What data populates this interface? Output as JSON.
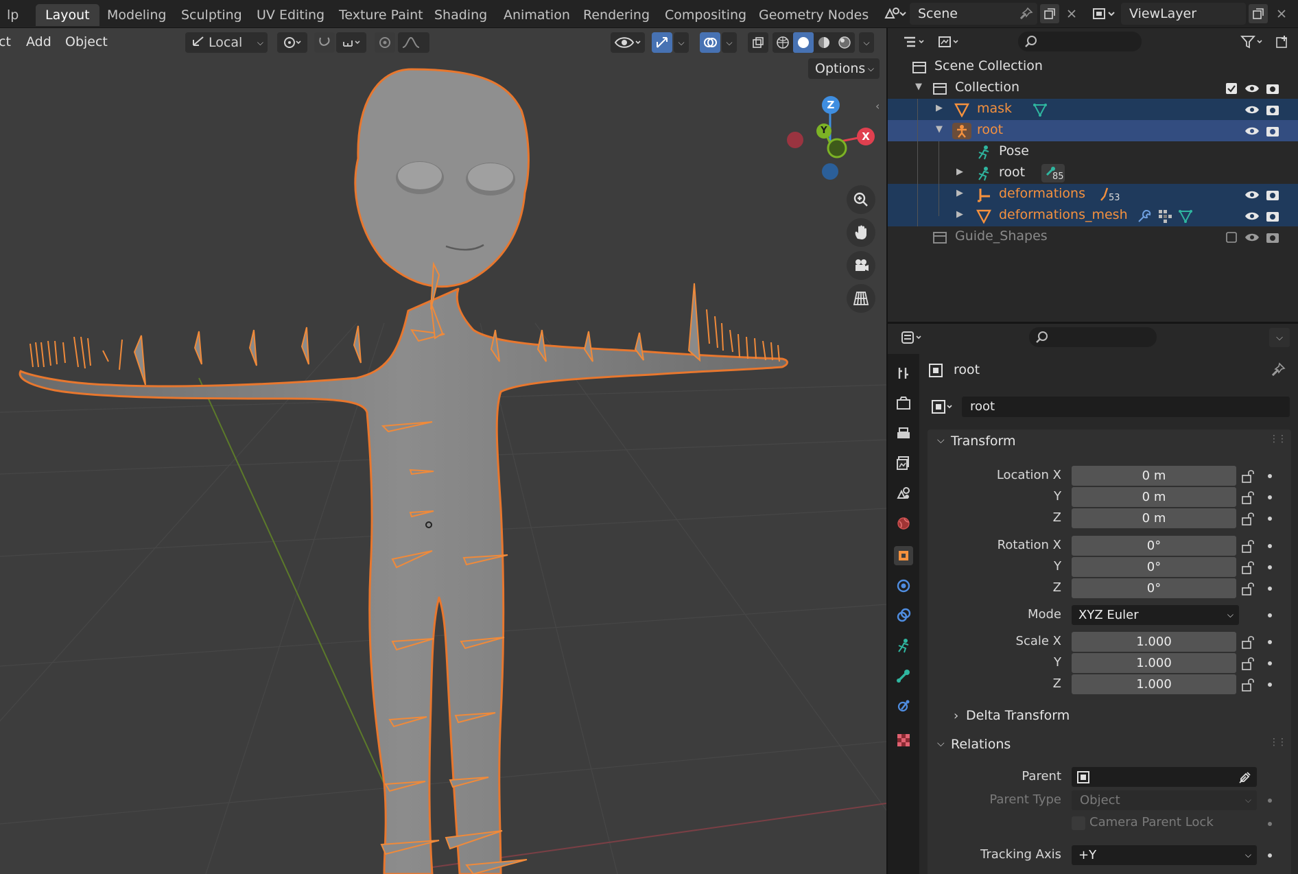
{
  "workspace_tabs": [
    "Layout",
    "Modeling",
    "Sculpting",
    "UV Editing",
    "Texture Paint",
    "Shading",
    "Animation",
    "Rendering",
    "Compositing",
    "Geometry Nodes"
  ],
  "edge_menu_label": "lp",
  "scene": {
    "name": "Scene",
    "view_layer": "ViewLayer"
  },
  "viewport": {
    "menu_partial": "ct",
    "menus": [
      "Add",
      "Object"
    ],
    "orientation": "Local",
    "options_label": "Options",
    "gizmo_axes": {
      "x": "X",
      "y": "Y",
      "z": "Z"
    }
  },
  "outliner": {
    "scene_collection": "Scene Collection",
    "collection": "Collection",
    "items": [
      {
        "label": "mask"
      },
      {
        "label": "root"
      },
      {
        "label": "Pose"
      },
      {
        "label": "root",
        "badge": "85"
      },
      {
        "label": "deformations",
        "badge": "53"
      },
      {
        "label": "deformations_mesh"
      },
      {
        "label": "Guide_Shapes"
      }
    ]
  },
  "properties": {
    "object_name": "root",
    "datablock_name": "root",
    "transform_title": "Transform",
    "location_label": "Location X",
    "y_label": "Y",
    "z_label": "Z",
    "location": [
      "0 m",
      "0 m",
      "0 m"
    ],
    "rotation_label": "Rotation X",
    "rotation": [
      "0°",
      "0°",
      "0°"
    ],
    "mode_label": "Mode",
    "mode_value": "XYZ Euler",
    "scale_label": "Scale X",
    "scale": [
      "1.000",
      "1.000",
      "1.000"
    ],
    "delta_transform": "Delta Transform",
    "relations_title": "Relations",
    "parent_label": "Parent",
    "parent_type_label": "Parent Type",
    "parent_type_value": "Object",
    "camera_parent_lock": "Camera Parent Lock",
    "tracking_axis_label": "Tracking Axis",
    "tracking_axis_value": "+Y"
  },
  "colors": {
    "accent": "#4772b3",
    "selected_orange": "#f5913e",
    "axis_x": "#e0404f",
    "axis_y": "#7cb325",
    "axis_z": "#3f8ee0"
  }
}
